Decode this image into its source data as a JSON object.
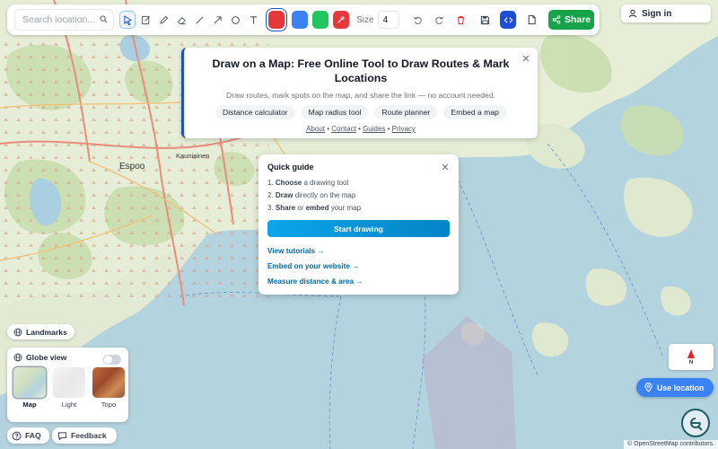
{
  "search": {
    "placeholder": "Search location..."
  },
  "toolbar": {
    "tools": [
      {
        "name": "select-tool",
        "icon": "cursor-arrow"
      },
      {
        "name": "edit-tool",
        "icon": "pencil-square"
      },
      {
        "name": "pen-tool",
        "icon": "pen"
      },
      {
        "name": "eraser-tool",
        "icon": "eraser"
      },
      {
        "name": "line-tool",
        "icon": "line"
      },
      {
        "name": "arrow-tool",
        "icon": "arrow"
      },
      {
        "name": "circle-tool",
        "icon": "circle"
      },
      {
        "name": "text-tool",
        "icon": "text-T"
      }
    ],
    "colors": [
      "#e5383b",
      "#3b82f6",
      "#22c55e"
    ],
    "size_label": "Size",
    "size_value": "4",
    "share_label": "Share"
  },
  "signin": {
    "label": "Sign in"
  },
  "info": {
    "title": "Draw on a Map: Free Online Tool to Draw Routes & Mark Locations",
    "subtitle": "Draw routes, mark spots on the map, and share the link — no account needed.",
    "chips": [
      "Distance calculator",
      "Map radius tool",
      "Route planner",
      "Embed a map"
    ],
    "links": [
      "About",
      "Contact",
      "Guides",
      "Privacy"
    ]
  },
  "guide": {
    "title": "Quick guide",
    "steps": [
      {
        "num": "1.",
        "bold": "Choose",
        "rest": " a drawing tool"
      },
      {
        "num": "2.",
        "bold": "Draw",
        "rest": " directly on the map"
      },
      {
        "num": "3.",
        "bold": "Share",
        "mid": " or ",
        "bold2": "embed",
        "rest": " your map"
      }
    ],
    "start_label": "Start drawing",
    "links": [
      "View tutorials →",
      "Embed on your website →",
      "Measure distance & area →"
    ]
  },
  "map_labels": {
    "espoo": "Espoo",
    "kauniainen": "Kauniainen"
  },
  "left_controls": {
    "landmarks": "Landmarks",
    "globe_view": "Globe view",
    "layers": [
      "Map",
      "Light",
      "Topo"
    ],
    "faq": "FAQ",
    "feedback": "Feedback"
  },
  "right_controls": {
    "compass_label": "N",
    "use_location": "Use location",
    "attribution": "© OpenStreetMap contributors."
  }
}
